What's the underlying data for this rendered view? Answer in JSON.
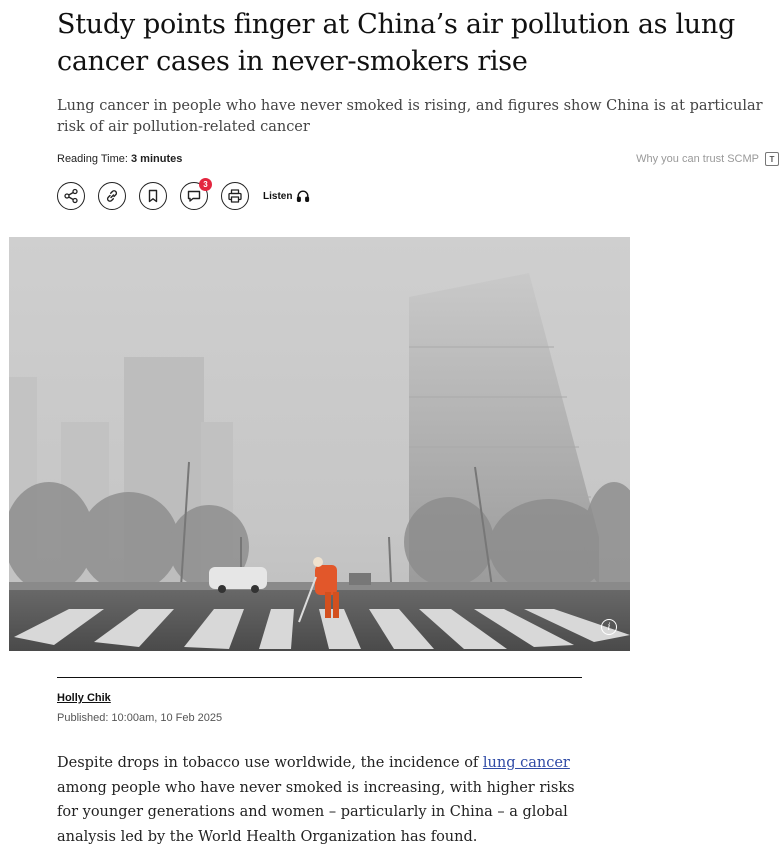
{
  "article": {
    "headline": "Study points finger at China’s air pollution as lung cancer cases in never-smokers rise",
    "subheadline": "Lung cancer in people who have never smoked is rising, and figures show China is at particular risk of air pollution-related cancer",
    "reading_time_label": "Reading Time:",
    "reading_time_value": "3 minutes",
    "trust_label": "Why you can trust SCMP",
    "trust_icon": "T"
  },
  "actions": {
    "share_icon": "share-icon",
    "link_icon": "link-icon",
    "bookmark_icon": "bookmark-icon",
    "comment_icon": "comment-icon",
    "comment_count": "3",
    "print_icon": "print-icon",
    "listen_label": "Listen",
    "listen_icon": "headphones-icon"
  },
  "hero": {
    "info_icon": "i"
  },
  "byline": {
    "author": "Holly Chik",
    "published": "Published: 10:00am, 10 Feb 2025"
  },
  "body": {
    "p1_before": "Despite drops in tobacco use worldwide, the incidence of ",
    "p1_link": "lung cancer",
    "p1_after": " among people who have never smoked is increasing, with higher risks for younger generations and women – particularly in China – a global analysis led by the World Health Organization has found."
  },
  "colors": {
    "badge": "#e3263f",
    "link": "#2f4ba6",
    "text": "#111111"
  }
}
